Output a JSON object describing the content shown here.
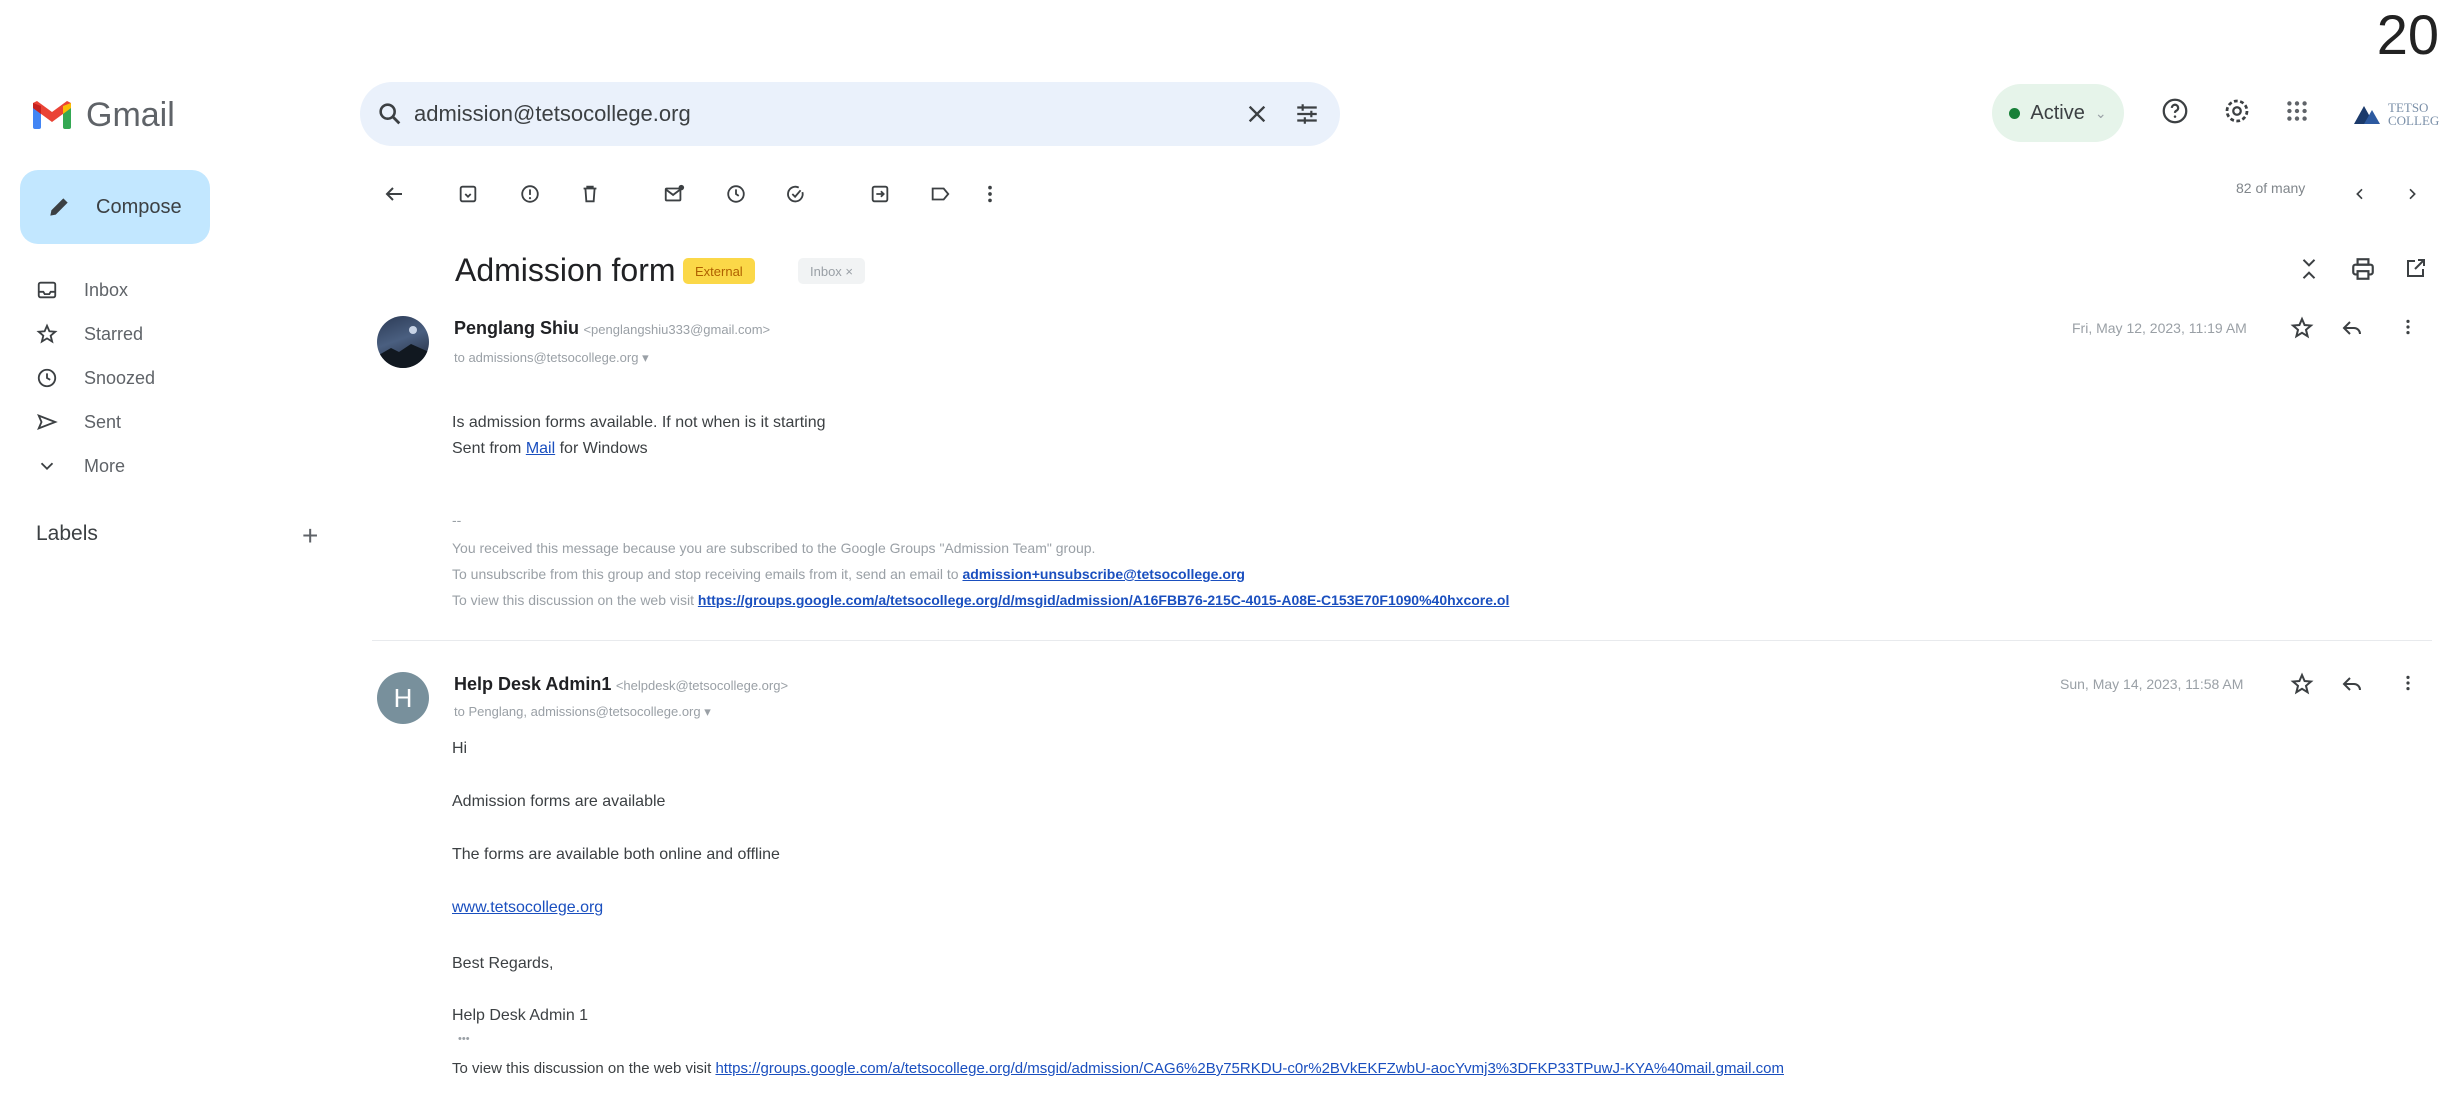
{
  "page_number": "20",
  "app": {
    "name": "Gmail"
  },
  "search": {
    "query": "admission@tetsocollege.org"
  },
  "header": {
    "status": "Active",
    "brand_line1": "TETSO",
    "brand_line2": "COLLEG"
  },
  "sidebar": {
    "compose_label": "Compose",
    "items": [
      {
        "label": "Inbox"
      },
      {
        "label": "Starred"
      },
      {
        "label": "Snoozed"
      },
      {
        "label": "Sent"
      },
      {
        "label": "More"
      }
    ],
    "labels_title": "Labels",
    "labels_add": "+"
  },
  "toolbar": {
    "pager": "82 of many"
  },
  "thread": {
    "subject": "Admission form",
    "chips": {
      "external": "External",
      "inbox": "Inbox ×"
    },
    "messages": [
      {
        "sender": "Penglang Shiu",
        "email": "<penglangshiu333@gmail.com>",
        "to": "to admissions@tetsocollege.org ▾",
        "date": "Fri, May 12, 2023, 11:19 AM",
        "body_line1": "Is admission forms available. If not when is it starting",
        "body_line2_pre": "Sent from ",
        "body_line2_link": "Mail",
        "body_line2_post": " for Windows",
        "dashes": "--",
        "footer_line1": "You received this message because you are subscribed to the Google Groups \"Admission Team\" group.",
        "footer_line2_pre": "To unsubscribe from this group and stop receiving emails from it, send an email to ",
        "footer_line2_link": "admission+unsubscribe@tetsocollege.org",
        "footer_line3_pre": "To view this discussion on the web visit ",
        "footer_line3_link": "https://groups.google.com/a/tetsocollege.org/d/msgid/admission/A16FBB76-215C-4015-A08E-C153E70F1090%40hxcore.ol"
      },
      {
        "avatar_letter": "H",
        "sender": "Help Desk Admin1",
        "email": "<helpdesk@tetsocollege.org>",
        "to": "to Penglang, admissions@tetsocollege.org ▾",
        "date": "Sun, May 14, 2023, 11:58 AM",
        "greeting": "Hi",
        "line1": "Admission forms are available",
        "line2": "The forms are available both online and offline",
        "website": "www.tetsocollege.org",
        "regards": "Best Regards,",
        "signature": "Help Desk Admin 1",
        "ellipsis": "•••",
        "footer_pre": "To view this discussion on the web visit ",
        "footer_link": "https://groups.google.com/a/tetsocollege.org/d/msgid/admission/CAG6%2By75RKDU-c0r%2BVkEKFZwbU-aocYvmj3%3DFKP33TPuwJ-KYA%40mail.gmail.com"
      }
    ]
  },
  "colors": {
    "compose_bg": "#c2e7ff",
    "search_bg": "#eaf1fb",
    "external_chip": "#fbd848",
    "link": "#1a4fbf"
  },
  "icons": [
    "search-icon",
    "clear-icon",
    "filter-icon",
    "help-icon",
    "settings-icon",
    "apps-icon",
    "pencil-icon",
    "inbox-icon",
    "star-icon",
    "clock-icon",
    "send-icon",
    "chevron-down-icon",
    "back-icon",
    "archive-icon",
    "report-icon",
    "trash-icon",
    "mark-unread-icon",
    "snooze-icon",
    "add-task-icon",
    "move-to-icon",
    "label-icon",
    "more-vert-icon",
    "chevron-left-icon",
    "chevron-right-icon",
    "collapse-icon",
    "print-icon",
    "open-new-window-icon",
    "reply-icon"
  ]
}
